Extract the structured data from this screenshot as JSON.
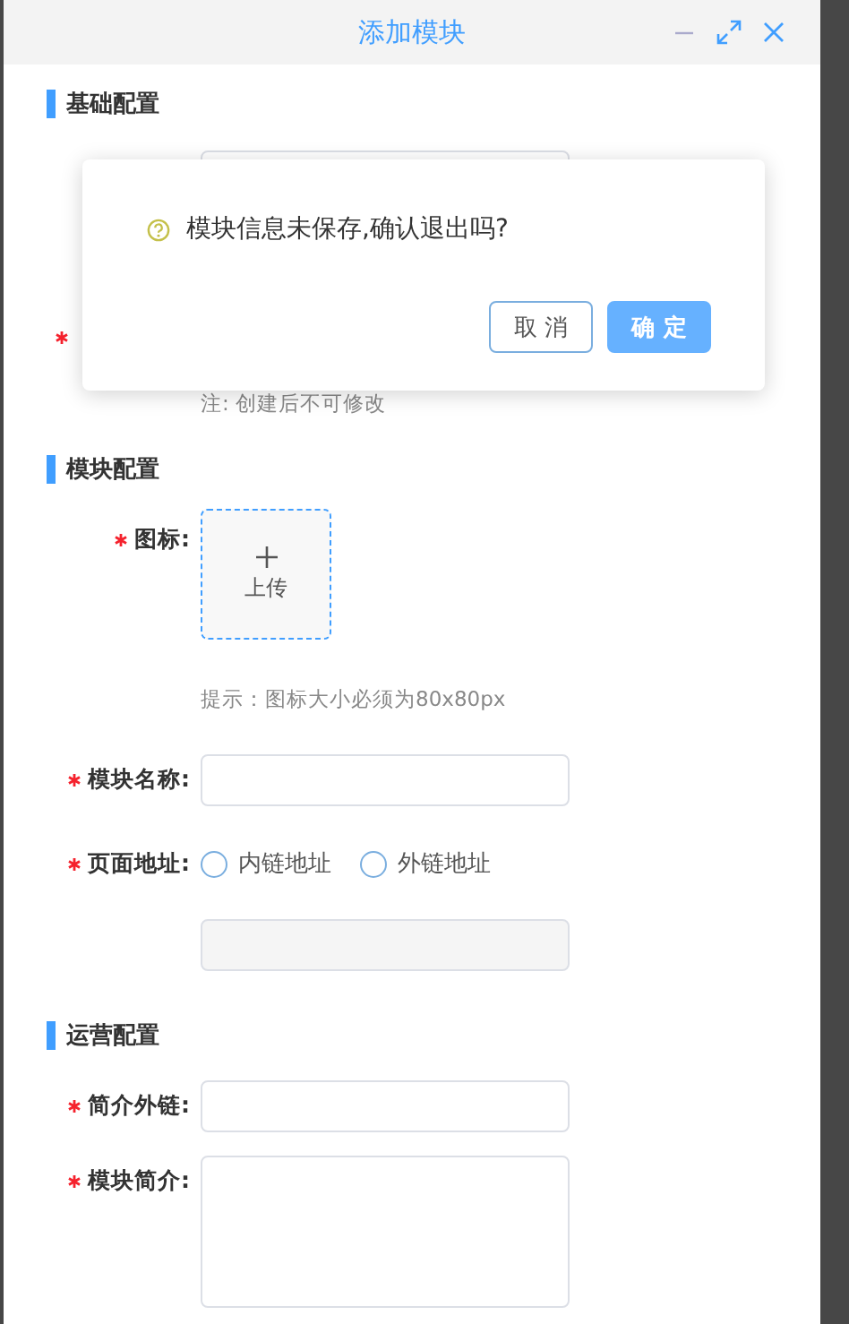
{
  "dialog": {
    "title": "添加模块"
  },
  "sections": [
    {
      "title": "基础配置",
      "rows": [
        {
          "kind": "covered_field"
        },
        {
          "kind": "covered_label",
          "required": true
        },
        {
          "kind": "note",
          "text": "注: 创建后不可修改"
        }
      ]
    },
    {
      "title": "模块配置",
      "rows": [
        {
          "kind": "upload",
          "label": "图标:",
          "required": true,
          "text": "上传"
        },
        {
          "kind": "note",
          "text": "提示：图标大小必须为80x80px"
        },
        {
          "kind": "input",
          "label": "模块名称:",
          "required": true
        },
        {
          "kind": "radio",
          "label": "页面地址:",
          "required": true,
          "options": [
            {
              "label": "内链地址",
              "selected": false
            },
            {
              "label": "外链地址",
              "selected": false
            }
          ]
        },
        {
          "kind": "input",
          "disabled": true
        }
      ]
    },
    {
      "title": "运营配置",
      "rows": [
        {
          "kind": "input",
          "label": "简介外链:",
          "required": true
        },
        {
          "kind": "textarea",
          "label": "模块简介:",
          "required": true
        }
      ]
    }
  ],
  "confirm": {
    "message": "模块信息未保存,确认退出吗?",
    "buttons": [
      {
        "label": "取 消",
        "kind": "default"
      },
      {
        "label": "确 定",
        "kind": "primary"
      }
    ]
  }
}
